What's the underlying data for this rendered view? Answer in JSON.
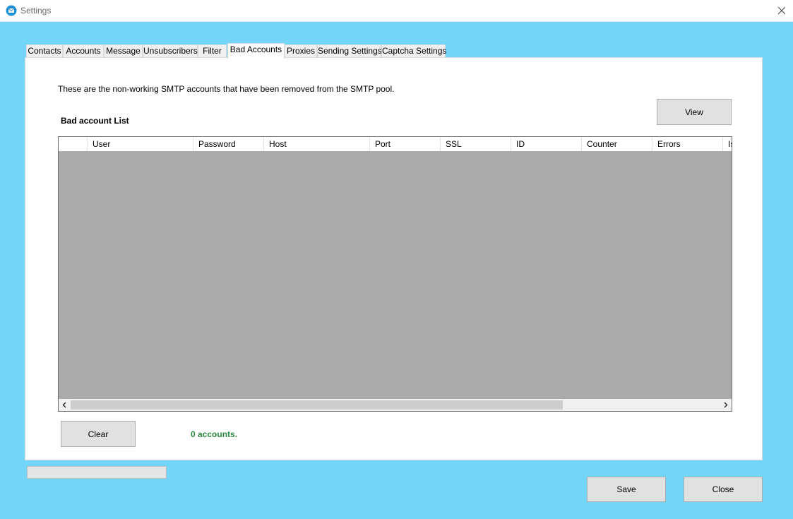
{
  "window": {
    "title": "Settings",
    "close_icon": "close-icon",
    "app_icon": "mail-app-icon"
  },
  "tabs": [
    {
      "label": "Contacts"
    },
    {
      "label": "Accounts"
    },
    {
      "label": "Message"
    },
    {
      "label": "Unsubscribers"
    },
    {
      "label": "Filter"
    },
    {
      "label": "Bad Accounts",
      "active": true
    },
    {
      "label": "Proxies"
    },
    {
      "label": "Sending Settings"
    },
    {
      "label": "Captcha Settings"
    }
  ],
  "bad_accounts": {
    "description": "These are the non-working SMTP accounts that have been removed from the SMTP pool.",
    "list_label": "Bad account  List",
    "view_button": "View",
    "columns": [
      "User",
      "Password",
      "Host",
      "Port",
      "SSL",
      "ID",
      "Counter",
      "Errors",
      "Is"
    ],
    "rows": [],
    "clear_button": "Clear",
    "count_text": "0 accounts.",
    "count_color": "#2e8b3f"
  },
  "progress": {
    "value": 0
  },
  "footer": {
    "save_button": "Save",
    "close_button": "Close"
  },
  "colors": {
    "window_background": "#73d6f9",
    "grid_background": "#ababab"
  }
}
